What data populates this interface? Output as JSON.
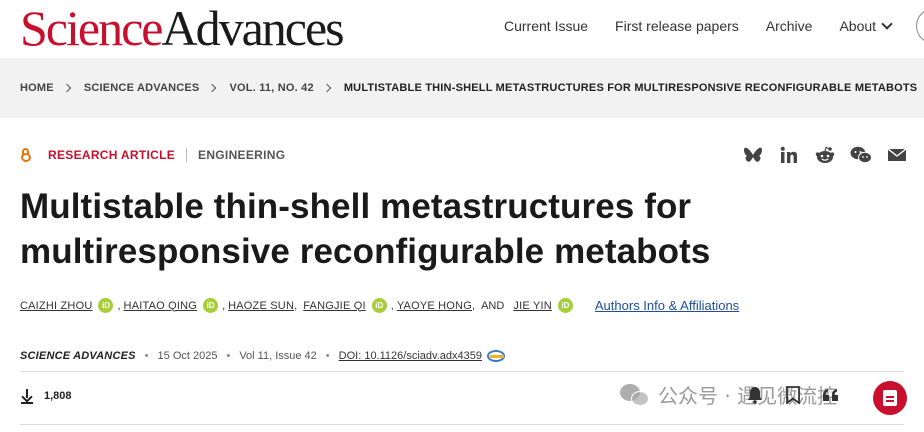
{
  "header": {
    "logo_science": "Science",
    "logo_advances": "Advances",
    "nav": [
      "Current Issue",
      "First release papers",
      "Archive",
      "About"
    ]
  },
  "breadcrumb": [
    "HOME",
    "SCIENCE ADVANCES",
    "VOL. 11, NO. 42",
    "MULTISTABLE THIN-SHELL METASTRUCTURES FOR MULTIRESPONSIVE RECONFIGURABLE METABOTS"
  ],
  "article": {
    "type": "RESEARCH ARTICLE",
    "subject": "ENGINEERING",
    "title_line1": "Multistable thin-shell metastructures for",
    "title_line2": "multiresponsive reconfigurable metabots",
    "authors": [
      "CAIZHI ZHOU",
      "HAITAO QING",
      "HAOZE SUN",
      "FANGJIE QI",
      "YAOYE HONG",
      "JIE YIN"
    ],
    "and_text": "AND",
    "orcid_label": "iD",
    "affiliations_link": "Authors Info & Affiliations",
    "journal": "SCIENCE ADVANCES",
    "date": "15 Oct 2025",
    "volume": "Vol 11, Issue 42",
    "doi": "DOI: 10.1126/sciadv.adx4359",
    "downloads": "1,808"
  },
  "share_icons": [
    "bluesky-icon",
    "linkedin-icon",
    "reddit-icon",
    "wechat-icon",
    "email-icon"
  ],
  "watermark": "公众号 · 遇见微流控",
  "colors": {
    "brand_red": "#c8102e",
    "orcid_green": "#a6ce39",
    "link_blue": "#1f4e9c",
    "oa_orange": "#e8740c"
  }
}
